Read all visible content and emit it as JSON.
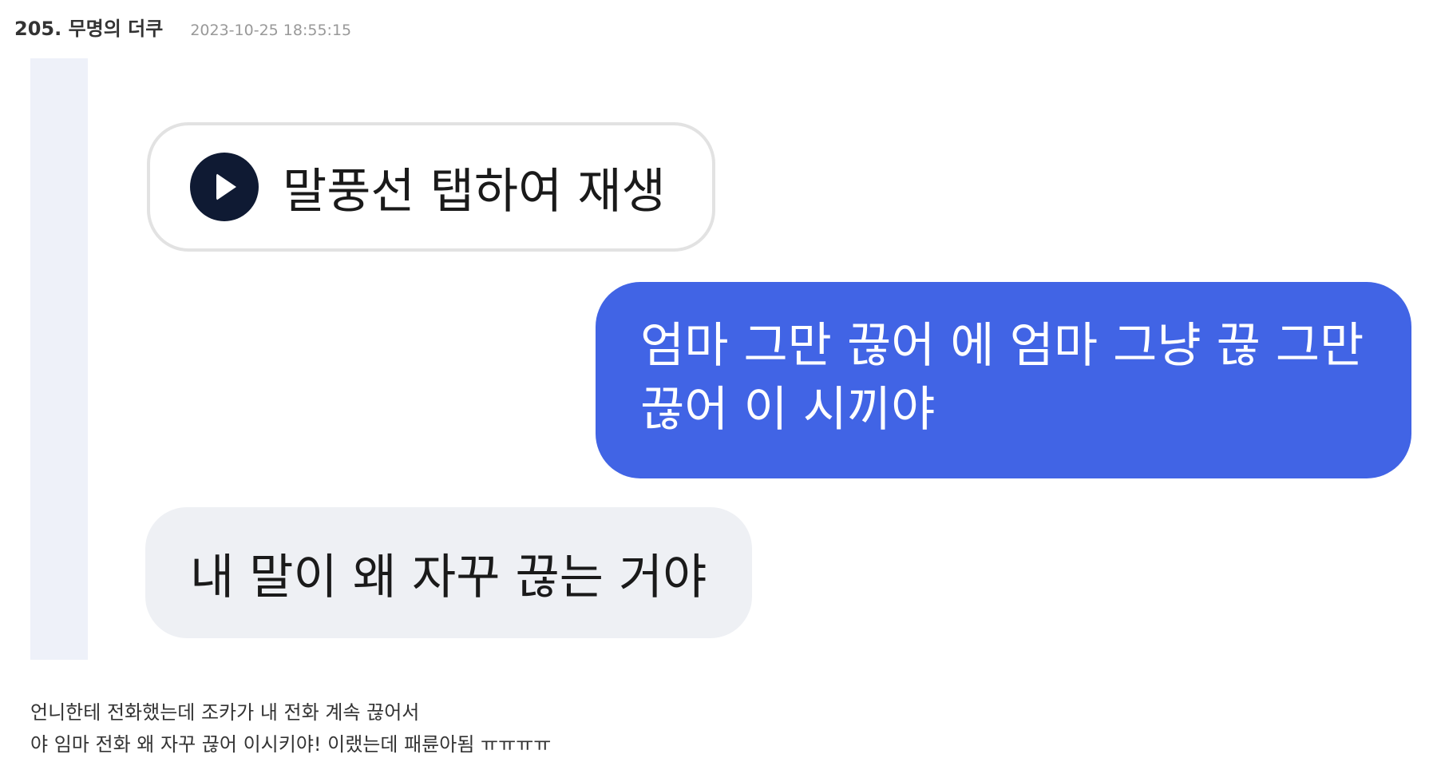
{
  "post": {
    "author": "205. 무명의 더쿠",
    "timestamp": "2023-10-25 18:55:15"
  },
  "quote_image": {
    "play_bubble": {
      "icon": "play-icon",
      "label": "말풍선 탭하여 재생"
    },
    "sent_message": {
      "line1": "엄마 그만 끊어 에 엄마 그냥 끊 그만",
      "line2": "끊어 이 시끼야"
    },
    "received_message": "내 말이 왜 자꾸 끊는 거야",
    "colors": {
      "sent_bubble": "#4164e5",
      "received_bubble": "#eef0f4",
      "play_button": "#0f1a33",
      "quote_bar": "#eef1f9"
    }
  },
  "body": {
    "line1": "언니한테 전화했는데 조카가 내 전화 계속 끊어서",
    "line2": "야 임마 전화 왜 자꾸 끊어 이시키야! 이랬는데 패륜아됨 ㅠㅠㅠㅠ"
  }
}
